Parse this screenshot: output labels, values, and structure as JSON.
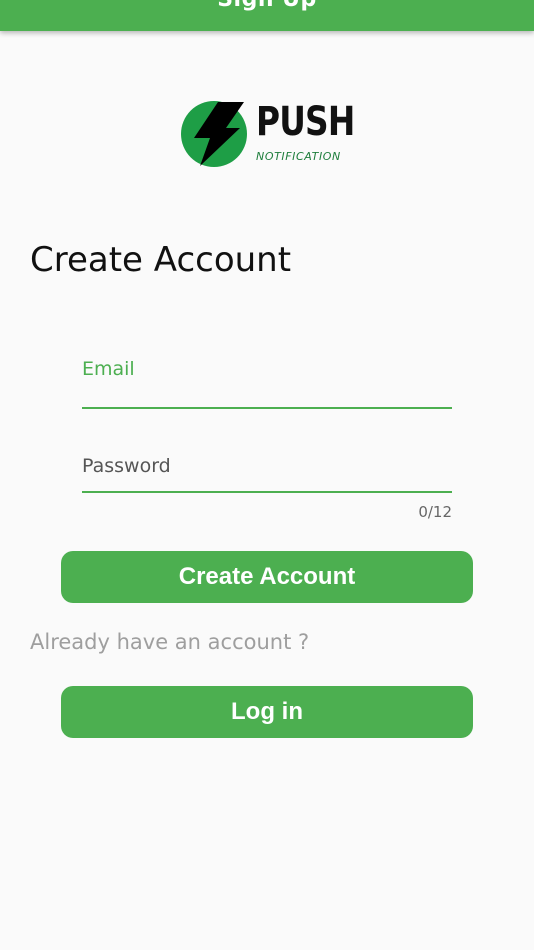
{
  "app_bar": {
    "title": "Sign Up"
  },
  "logo": {
    "word": "PUSH",
    "sub": "NOTIFICATION",
    "icon": "lightning-bolt-icon",
    "circle_color": "#1e9e46"
  },
  "page_title": "Create Account",
  "form": {
    "email_label": "Email",
    "password_label": "Password",
    "password_counter": "0/12"
  },
  "buttons": {
    "create_account": "Create Account",
    "log_in": "Log in"
  },
  "already_text": "Already have an account ?",
  "colors": {
    "accent": "#4caf50",
    "background": "#fafafa"
  }
}
